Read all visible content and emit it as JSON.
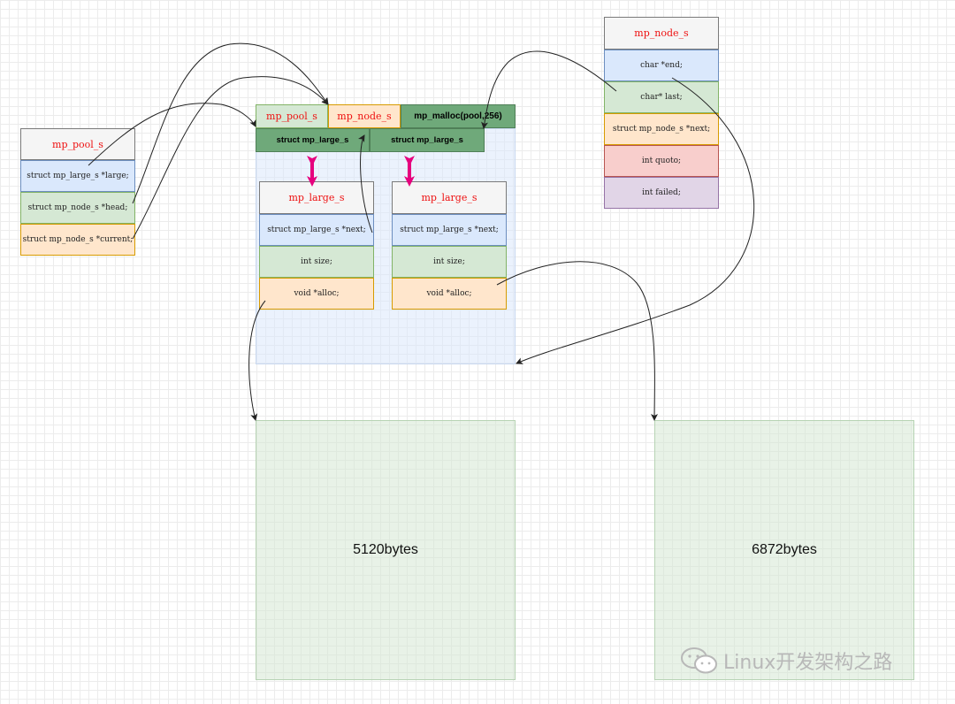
{
  "pool_struct": {
    "title": "mp_pool_s",
    "fields": [
      "struct mp_large_s *large;",
      "struct mp_node_s *head;",
      "struct mp_node_s *current;"
    ]
  },
  "block_header": {
    "pool_label": "mp_pool_s",
    "node_label": "mp_node_s",
    "malloc_label": "mp_malloc(pool,256)",
    "large_slot_1": "struct mp_large_s",
    "large_slot_2": "struct mp_large_s"
  },
  "large_struct_1": {
    "title": "mp_large_s",
    "fields": [
      "struct mp_large_s *next;",
      "int size;",
      "void *alloc;"
    ]
  },
  "large_struct_2": {
    "title": "mp_large_s",
    "fields": [
      "struct mp_large_s *next;",
      "int size;",
      "void *alloc;"
    ]
  },
  "node_struct": {
    "title": "mp_node_s",
    "fields": [
      "char *end;",
      "char* last;",
      "struct mp_node_s *next;",
      "int quoto;",
      "int failed;"
    ]
  },
  "memory_blocks": [
    "5120bytes",
    "6872bytes"
  ],
  "watermark": "Linux开发架构之路",
  "colors": {
    "title_red": "#ee1111",
    "arrow_pink": "#e6007e",
    "header_dark_green": "#6fa97a"
  }
}
